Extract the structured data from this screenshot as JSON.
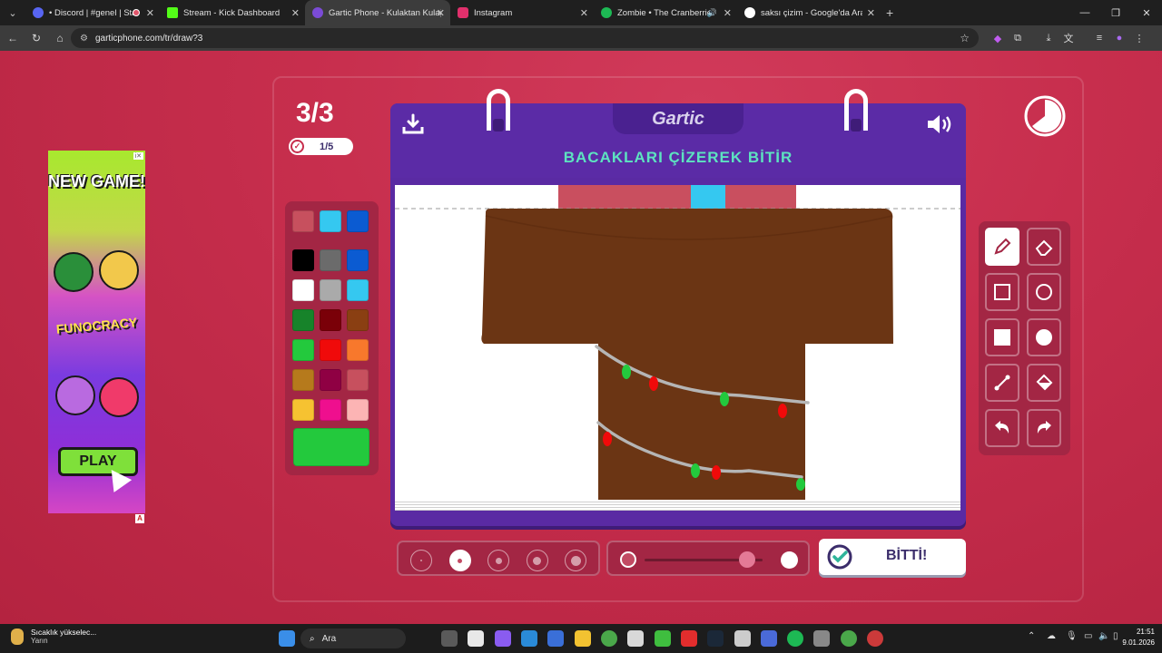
{
  "browser": {
    "tabs": [
      {
        "title": "• Discord | #genel | Starmy",
        "fav": "#5865f2"
      },
      {
        "title": "Stream - Kick Dashboard",
        "fav": "#53fc18"
      },
      {
        "title": "Gartic Phone - Kulaktan Kulağa",
        "fav": "#7b4bd6"
      },
      {
        "title": "Instagram",
        "fav": "#e1306c"
      },
      {
        "title": "Zombie • The Cranberries",
        "fav": "#1db954"
      },
      {
        "title": "saksı çizim - Google'da Ara",
        "fav": "#ffffff"
      }
    ],
    "url": "garticphone.com/tr/draw?3"
  },
  "game": {
    "round": "3/3",
    "progress": "1/5",
    "logo": "Gartic",
    "prompt": "BACAKLARI ÇİZEREK BİTİR",
    "done_label": "BİTTİ!",
    "palette": [
      "#c7505e",
      "#35c8f0",
      "#0b5bd2",
      "#000000",
      "#6b6b6b",
      "#0b5bd2",
      "#ffffff",
      "#aaaaaa",
      "#35c8f0",
      "#17832a",
      "#7a0008",
      "#8a3f12",
      "#23c93d",
      "#f00a0a",
      "#f8782c",
      "#b67a1c",
      "#8f0043",
      "#c7505e",
      "#f6c231",
      "#ef0f8e",
      "#fcb4b4"
    ],
    "selected_color": "#23c93d",
    "tools": [
      "pencil-icon",
      "eraser-icon",
      "square-outline-icon",
      "circle-outline-icon",
      "square-filled-icon",
      "circle-filled-icon",
      "line-icon",
      "fill-bucket-icon",
      "undo-icon",
      "redo-icon"
    ],
    "brush_sizes": [
      1,
      2,
      3,
      4,
      5
    ],
    "selected_size": 2,
    "opacity_level": 0.87
  },
  "ad": {
    "headline": "NEW GAME!",
    "brand": "FUNOCRACY",
    "cta": "PLAY"
  },
  "taskbar": {
    "weather_title": "Sıcaklık yükselec...",
    "weather_sub": "Yarın",
    "search": "Ara",
    "time": "21:51",
    "date": "9.01.2026"
  }
}
